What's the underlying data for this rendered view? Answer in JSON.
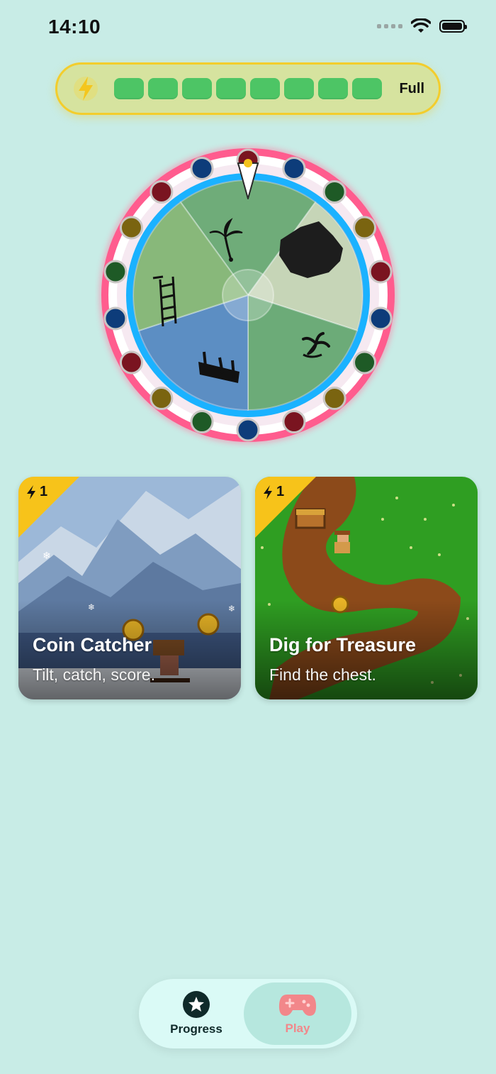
{
  "status_bar": {
    "time": "14:10"
  },
  "energy": {
    "label": "Full",
    "segments": 8,
    "filled": 8,
    "color": "#4dc565"
  },
  "wheel": {
    "sectors": [
      {
        "name": "palm-tree-island",
        "color": "#6fac79"
      },
      {
        "name": "dark-rock",
        "color": "#c6d5b7"
      },
      {
        "name": "small-palm",
        "color": "#6cab78"
      },
      {
        "name": "shipwreck",
        "color": "#5c8ec3"
      },
      {
        "name": "wooden-ladder",
        "color": "#88b87a"
      }
    ]
  },
  "games": [
    {
      "title": "Coin Catcher",
      "subtitle": "Tilt, catch, score.",
      "cost": "1"
    },
    {
      "title": "Dig for Treasure",
      "subtitle": "Find the chest.",
      "cost": "1"
    }
  ],
  "tabs": {
    "progress": "Progress",
    "play": "Play"
  },
  "colors": {
    "background": "#c8ece6",
    "accent_yellow": "#f7c31a",
    "ring_pink": "#ff5f8f",
    "ring_blue": "#1aa8ff"
  }
}
